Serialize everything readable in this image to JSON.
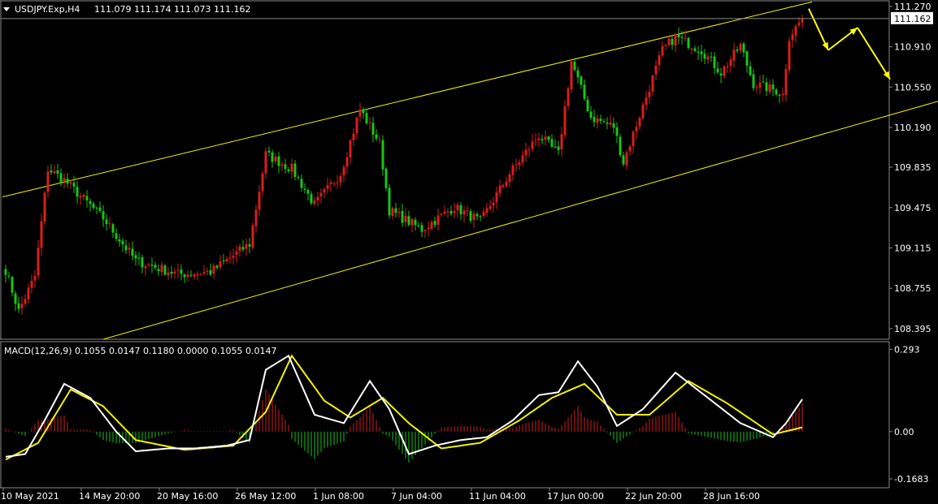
{
  "header": {
    "symbol": "USDJPY.Exp,H4",
    "ohlc": "111.079 111.174 111.073 111.162"
  },
  "macd": {
    "label": "MACD(12,26,9) 0.1055 0.0147 0.1180 0.0000 0.1055 0.0147",
    "ticks": [
      "0.293",
      "0.00",
      "-0.1683"
    ]
  },
  "colors": {
    "background": "#000000",
    "bull": "#d81e1e",
    "bear": "#19c519",
    "channel": "#f2f200",
    "forecast": "#ffff00",
    "macd_line": "#ffffff",
    "signal_line": "#f2f200",
    "grid": "#8a8a8a",
    "text": "#ffffff"
  },
  "chart_data": [
    {
      "type": "candlestick",
      "name": "price",
      "y_ticks": [
        "111.270",
        "110.910",
        "110.550",
        "110.190",
        "109.835",
        "109.475",
        "109.115",
        "108.755",
        "108.395"
      ],
      "current_price": "111.162",
      "x_ticks": [
        "10 May 2021",
        "14 May 20:00",
        "20 May 16:00",
        "26 May 12:00",
        "1 Jun 08:00",
        "7 Jun 04:00",
        "11 Jun 04:00",
        "17 Jun 00:00",
        "22 Jun 20:00",
        "28 Jun 16:00"
      ],
      "ylim": [
        108.3,
        111.32
      ],
      "anchor_closes": [
        {
          "bar": 0,
          "close": 108.92
        },
        {
          "bar": 4,
          "close": 108.55
        },
        {
          "bar": 9,
          "close": 108.86
        },
        {
          "bar": 13,
          "close": 109.82
        },
        {
          "bar": 18,
          "close": 109.72
        },
        {
          "bar": 30,
          "close": 109.38
        },
        {
          "bar": 40,
          "close": 109.0
        },
        {
          "bar": 53,
          "close": 108.88
        },
        {
          "bar": 63,
          "close": 108.9
        },
        {
          "bar": 75,
          "close": 109.15
        },
        {
          "bar": 80,
          "close": 109.95
        },
        {
          "bar": 88,
          "close": 109.82
        },
        {
          "bar": 95,
          "close": 109.5
        },
        {
          "bar": 103,
          "close": 109.78
        },
        {
          "bar": 109,
          "close": 110.35
        },
        {
          "bar": 115,
          "close": 110.05
        },
        {
          "bar": 118,
          "close": 109.45
        },
        {
          "bar": 128,
          "close": 109.28
        },
        {
          "bar": 138,
          "close": 109.48
        },
        {
          "bar": 146,
          "close": 109.35
        },
        {
          "bar": 155,
          "close": 109.78
        },
        {
          "bar": 164,
          "close": 110.12
        },
        {
          "bar": 170,
          "close": 109.95
        },
        {
          "bar": 174,
          "close": 110.78
        },
        {
          "bar": 180,
          "close": 110.28
        },
        {
          "bar": 187,
          "close": 110.2
        },
        {
          "bar": 190,
          "close": 109.88
        },
        {
          "bar": 196,
          "close": 110.38
        },
        {
          "bar": 202,
          "close": 110.88
        },
        {
          "bar": 206,
          "close": 111.0
        },
        {
          "bar": 214,
          "close": 110.88
        },
        {
          "bar": 220,
          "close": 110.68
        },
        {
          "bar": 226,
          "close": 110.92
        },
        {
          "bar": 230,
          "close": 110.58
        },
        {
          "bar": 237,
          "close": 110.52
        },
        {
          "bar": 239,
          "close": 110.48
        },
        {
          "bar": 241,
          "close": 111.0
        },
        {
          "bar": 245,
          "close": 111.16
        }
      ],
      "bar_count": 246,
      "channel_upper": [
        {
          "bar": -1,
          "price": 109.57
        },
        {
          "bar": 248,
          "price": 111.31
        }
      ],
      "channel_lower": [
        {
          "bar": 30,
          "price": 108.3
        },
        {
          "bar": 290,
          "price": 110.45
        }
      ],
      "forecast_path": [
        {
          "bar": 247,
          "price": 111.25
        },
        {
          "bar": 253,
          "price": 110.88
        },
        {
          "bar": 262,
          "price": 111.08
        },
        {
          "bar": 272,
          "price": 110.62
        }
      ]
    },
    {
      "type": "histogram+line",
      "name": "MACD(12,26,9)",
      "ylim": [
        -0.2,
        0.32
      ],
      "y_ticks": [
        0.293,
        0.0,
        -0.1683
      ],
      "series": [
        {
          "key": "main",
          "anchors": [
            {
              "bar": 0,
              "v": -0.09
            },
            {
              "bar": 6,
              "v": -0.08
            },
            {
              "bar": 12,
              "v": 0.04
            },
            {
              "bar": 18,
              "v": 0.17
            },
            {
              "bar": 26,
              "v": 0.12
            },
            {
              "bar": 34,
              "v": 0.0
            },
            {
              "bar": 40,
              "v": -0.07
            },
            {
              "bar": 50,
              "v": -0.06
            },
            {
              "bar": 58,
              "v": -0.06
            },
            {
              "bar": 68,
              "v": -0.05
            },
            {
              "bar": 75,
              "v": -0.03
            },
            {
              "bar": 80,
              "v": 0.22
            },
            {
              "bar": 87,
              "v": 0.27
            },
            {
              "bar": 95,
              "v": 0.06
            },
            {
              "bar": 104,
              "v": 0.03
            },
            {
              "bar": 112,
              "v": 0.18
            },
            {
              "bar": 118,
              "v": 0.08
            },
            {
              "bar": 124,
              "v": -0.08
            },
            {
              "bar": 132,
              "v": -0.05
            },
            {
              "bar": 140,
              "v": -0.03
            },
            {
              "bar": 148,
              "v": -0.02
            },
            {
              "bar": 156,
              "v": 0.04
            },
            {
              "bar": 164,
              "v": 0.13
            },
            {
              "bar": 170,
              "v": 0.14
            },
            {
              "bar": 176,
              "v": 0.25
            },
            {
              "bar": 182,
              "v": 0.16
            },
            {
              "bar": 188,
              "v": 0.02
            },
            {
              "bar": 196,
              "v": 0.08
            },
            {
              "bar": 206,
              "v": 0.21
            },
            {
              "bar": 216,
              "v": 0.12
            },
            {
              "bar": 226,
              "v": 0.03
            },
            {
              "bar": 236,
              "v": -0.02
            },
            {
              "bar": 240,
              "v": 0.03
            },
            {
              "bar": 245,
              "v": 0.115
            }
          ]
        },
        {
          "key": "signal",
          "anchors": [
            {
              "bar": 0,
              "v": -0.1
            },
            {
              "bar": 10,
              "v": -0.04
            },
            {
              "bar": 20,
              "v": 0.15
            },
            {
              "bar": 30,
              "v": 0.09
            },
            {
              "bar": 40,
              "v": -0.03
            },
            {
              "bar": 55,
              "v": -0.065
            },
            {
              "bar": 70,
              "v": -0.05
            },
            {
              "bar": 80,
              "v": 0.07
            },
            {
              "bar": 88,
              "v": 0.27
            },
            {
              "bar": 98,
              "v": 0.11
            },
            {
              "bar": 106,
              "v": 0.05
            },
            {
              "bar": 116,
              "v": 0.12
            },
            {
              "bar": 124,
              "v": 0.03
            },
            {
              "bar": 134,
              "v": -0.06
            },
            {
              "bar": 146,
              "v": -0.04
            },
            {
              "bar": 158,
              "v": 0.04
            },
            {
              "bar": 168,
              "v": 0.12
            },
            {
              "bar": 178,
              "v": 0.17
            },
            {
              "bar": 188,
              "v": 0.06
            },
            {
              "bar": 198,
              "v": 0.06
            },
            {
              "bar": 210,
              "v": 0.18
            },
            {
              "bar": 222,
              "v": 0.1
            },
            {
              "bar": 236,
              "v": -0.01
            },
            {
              "bar": 245,
              "v": 0.015
            }
          ]
        }
      ]
    }
  ]
}
